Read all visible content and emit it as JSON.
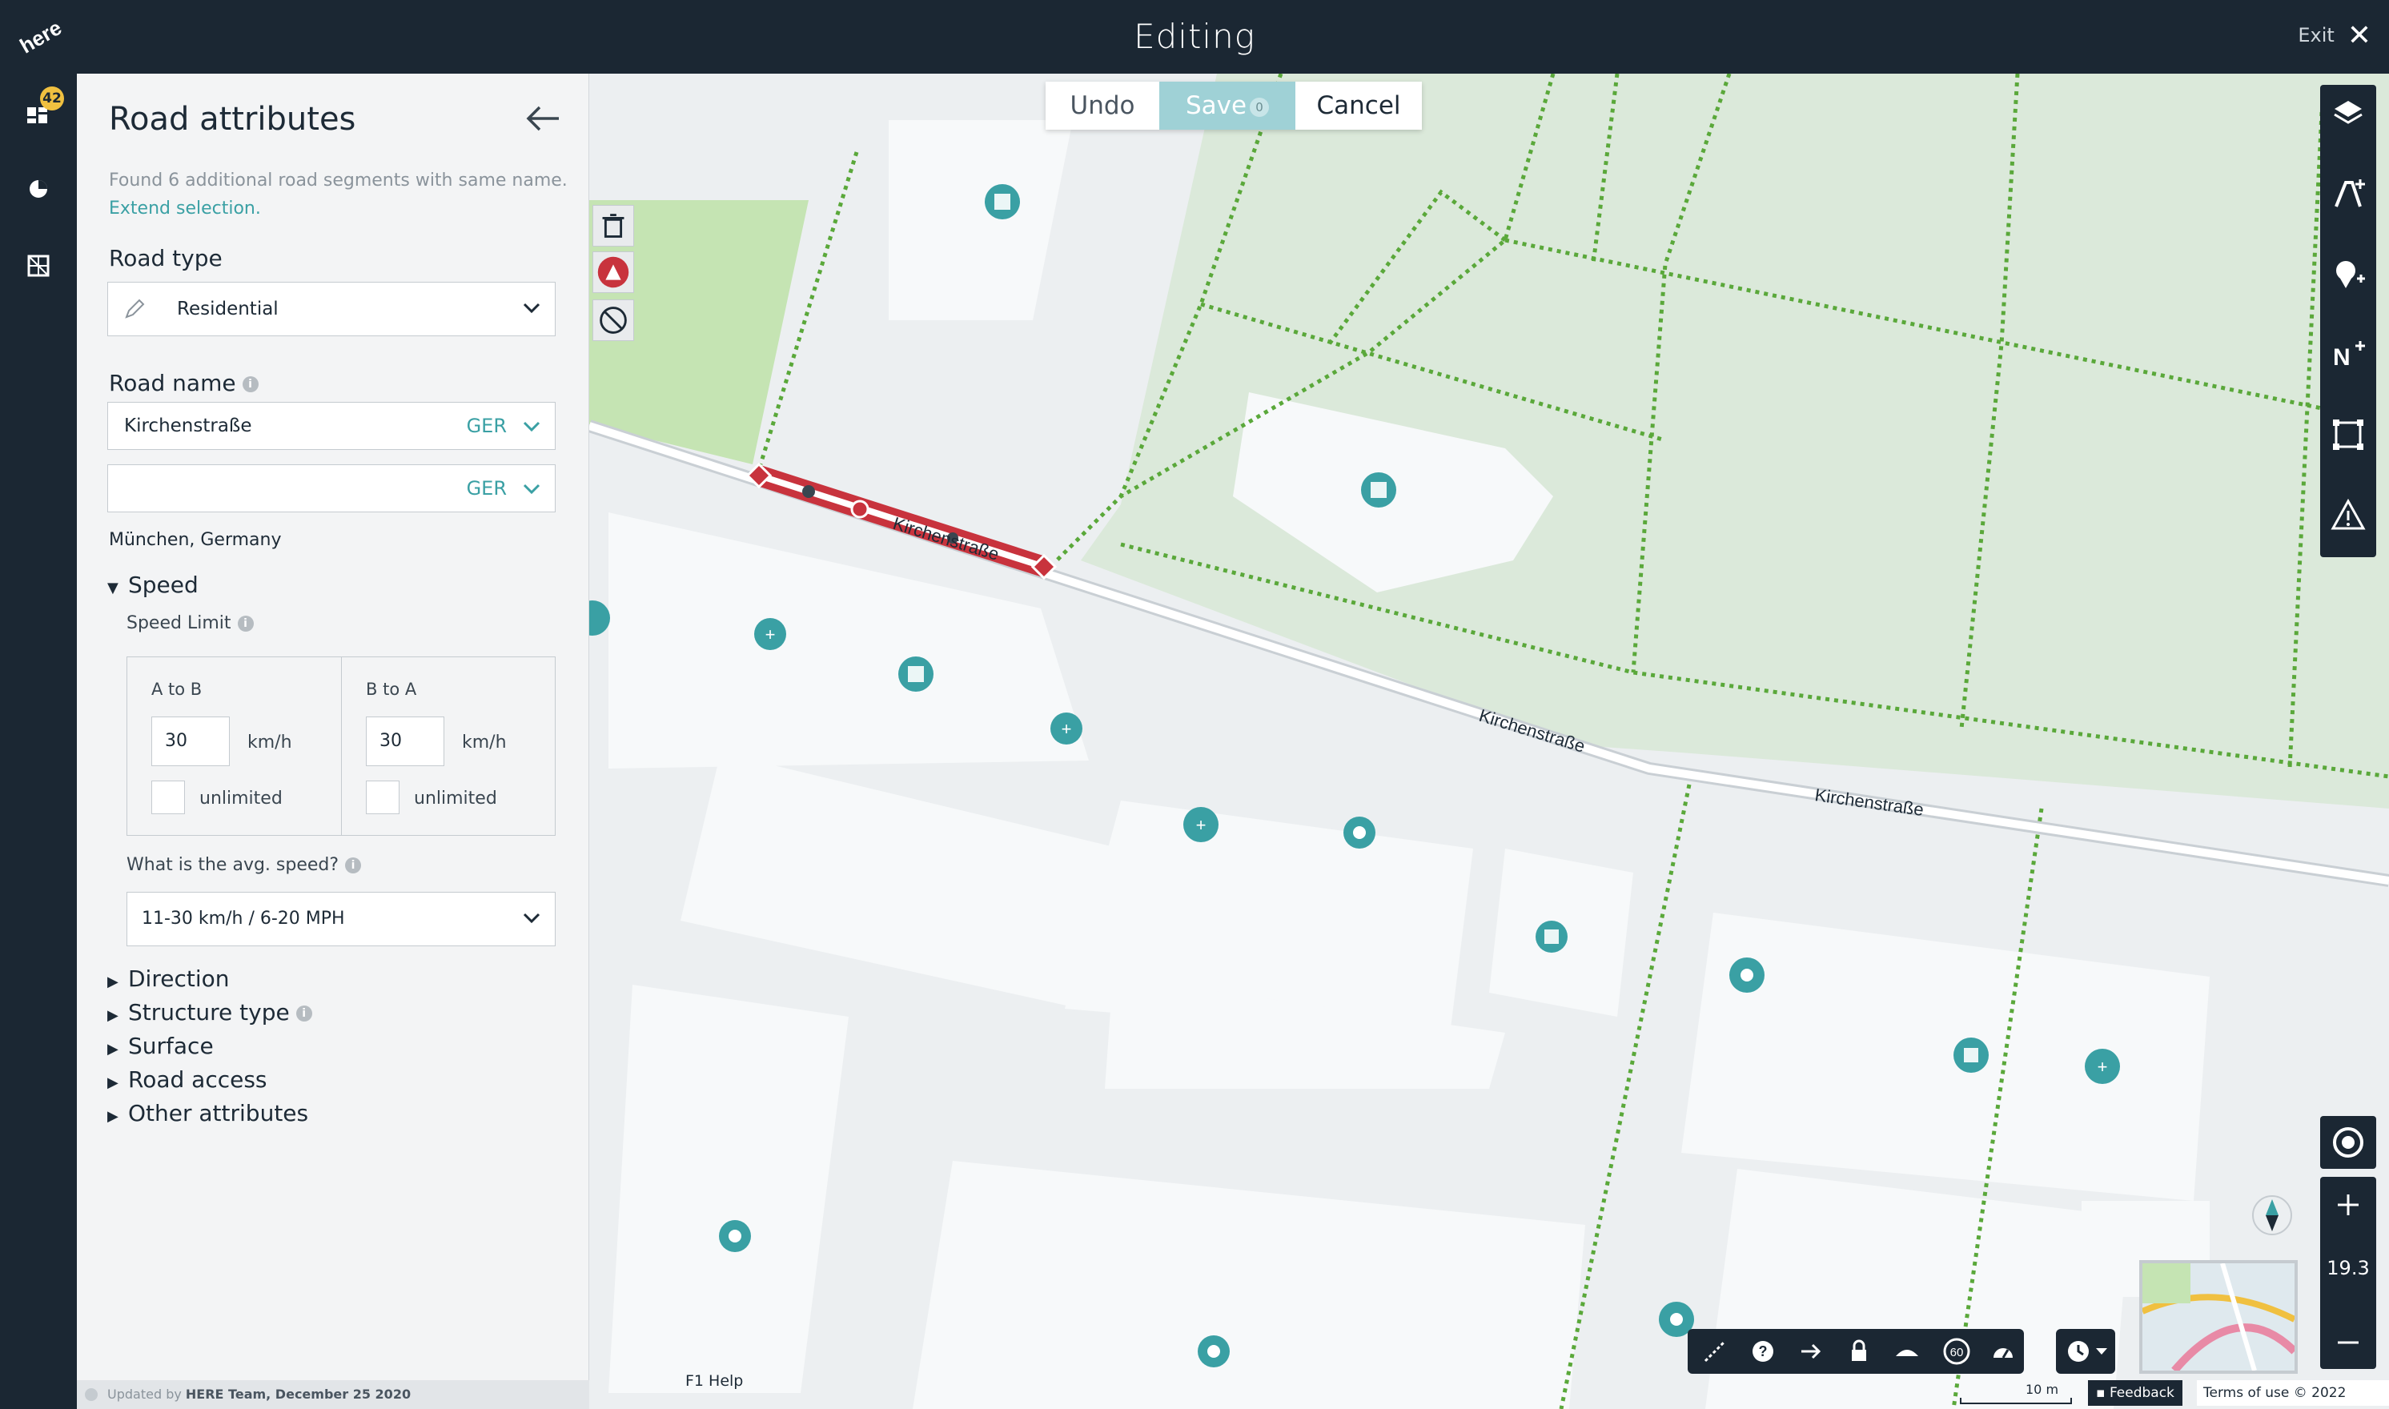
{
  "header": {
    "title": "Editing",
    "exit_label": "Exit",
    "logo_text": "here"
  },
  "rail": {
    "badge_count": "42"
  },
  "panel": {
    "title": "Road attributes",
    "notice_text": "Found 6 additional road segments with same name.",
    "notice_link": "Extend selection.",
    "road_type_label": "Road type",
    "road_type_value": "Residential",
    "road_name_label": "Road name",
    "road_name_primary": "Kirchenstraße",
    "road_name_lang_1": "GER",
    "road_name_secondary": "",
    "road_name_lang_2": "GER",
    "location": "München, Germany",
    "speed_section": "Speed",
    "speed_limit_label": "Speed Limit",
    "a_to_b_label": "A to B",
    "a_to_b_value": "30",
    "a_to_b_unit": "km/h",
    "a_to_b_unlimited": "unlimited",
    "b_to_a_label": "B to A",
    "b_to_a_value": "30",
    "b_to_a_unit": "km/h",
    "b_to_a_unlimited": "unlimited",
    "avg_speed_label": "What is the avg. speed?",
    "avg_speed_value": "11-30 km/h  /  6-20 MPH",
    "sections": [
      "Direction",
      "Structure type",
      "Surface",
      "Road access",
      "Other attributes"
    ],
    "footer_prefix": "Updated by",
    "footer_author": "HERE Team, December 25 2020"
  },
  "toolbar": {
    "undo_label": "Undo",
    "save_label": "Save",
    "save_count": "0",
    "cancel_label": "Cancel"
  },
  "map": {
    "street_labels": [
      "Kirchenstraße",
      "Kirchenstraße",
      "Kirchenstraße"
    ],
    "zoom_level": "19.3",
    "help_label": "F1 Help",
    "scale_label": "10 m",
    "feedback_label": "Feedback",
    "terms_label": "Terms of use © 2022 HERE",
    "speed_sign_label": "60"
  },
  "colors": {
    "chrome": "#1b2733",
    "accent": "#3aa0a4",
    "selected_road": "#c8333d",
    "park": "#dbe9da",
    "park_path": "#5aa83a"
  }
}
